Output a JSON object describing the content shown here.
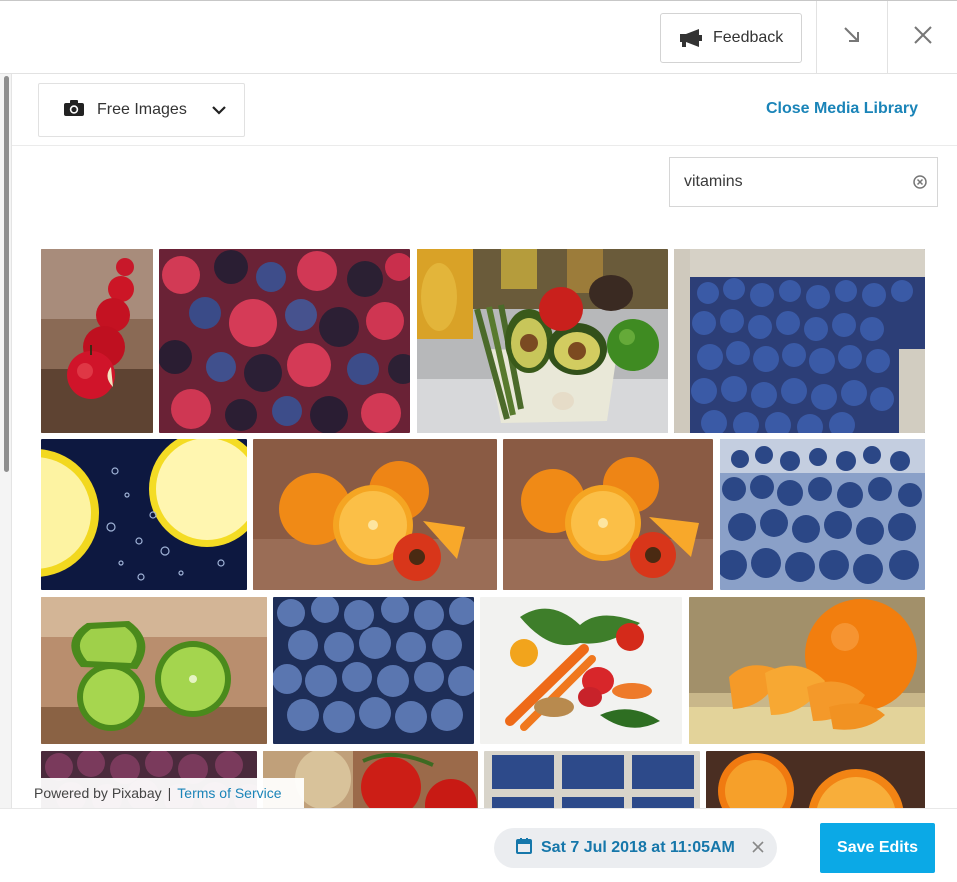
{
  "header": {
    "feedback_label": "Feedback",
    "icons": {
      "feedback": "megaphone-icon",
      "minimize": "arrow-down-right-icon",
      "close": "close-icon"
    }
  },
  "library": {
    "source_label": "Free Images",
    "source_icon": "camera-icon",
    "close_label": "Close Media Library"
  },
  "search": {
    "value": "vitamins",
    "clear_icon": "clear-circle-icon"
  },
  "images": [
    {
      "subject": "apple"
    },
    {
      "subject": "berries"
    },
    {
      "subject": "vegetables-avocado"
    },
    {
      "subject": "blueberries"
    },
    {
      "subject": "lemon"
    },
    {
      "subject": "orange"
    },
    {
      "subject": "orange"
    },
    {
      "subject": "blueberries"
    },
    {
      "subject": "lime"
    },
    {
      "subject": "blueberries"
    },
    {
      "subject": "vegetables"
    },
    {
      "subject": "tangerine"
    },
    {
      "subject": "grapes"
    },
    {
      "subject": "tomatoes"
    },
    {
      "subject": "blueberries"
    },
    {
      "subject": "orange"
    }
  ],
  "credit": {
    "powered_by": "Powered by Pixabay",
    "separator": "|",
    "terms_label": "Terms of Service"
  },
  "footer": {
    "schedule_date": "Sat 7 Jul 2018 at 11:05AM",
    "calendar_icon": "calendar-icon",
    "save_label": "Save Edits"
  },
  "colors": {
    "accent": "#1a84b8",
    "save_button": "#0ba9e6"
  }
}
